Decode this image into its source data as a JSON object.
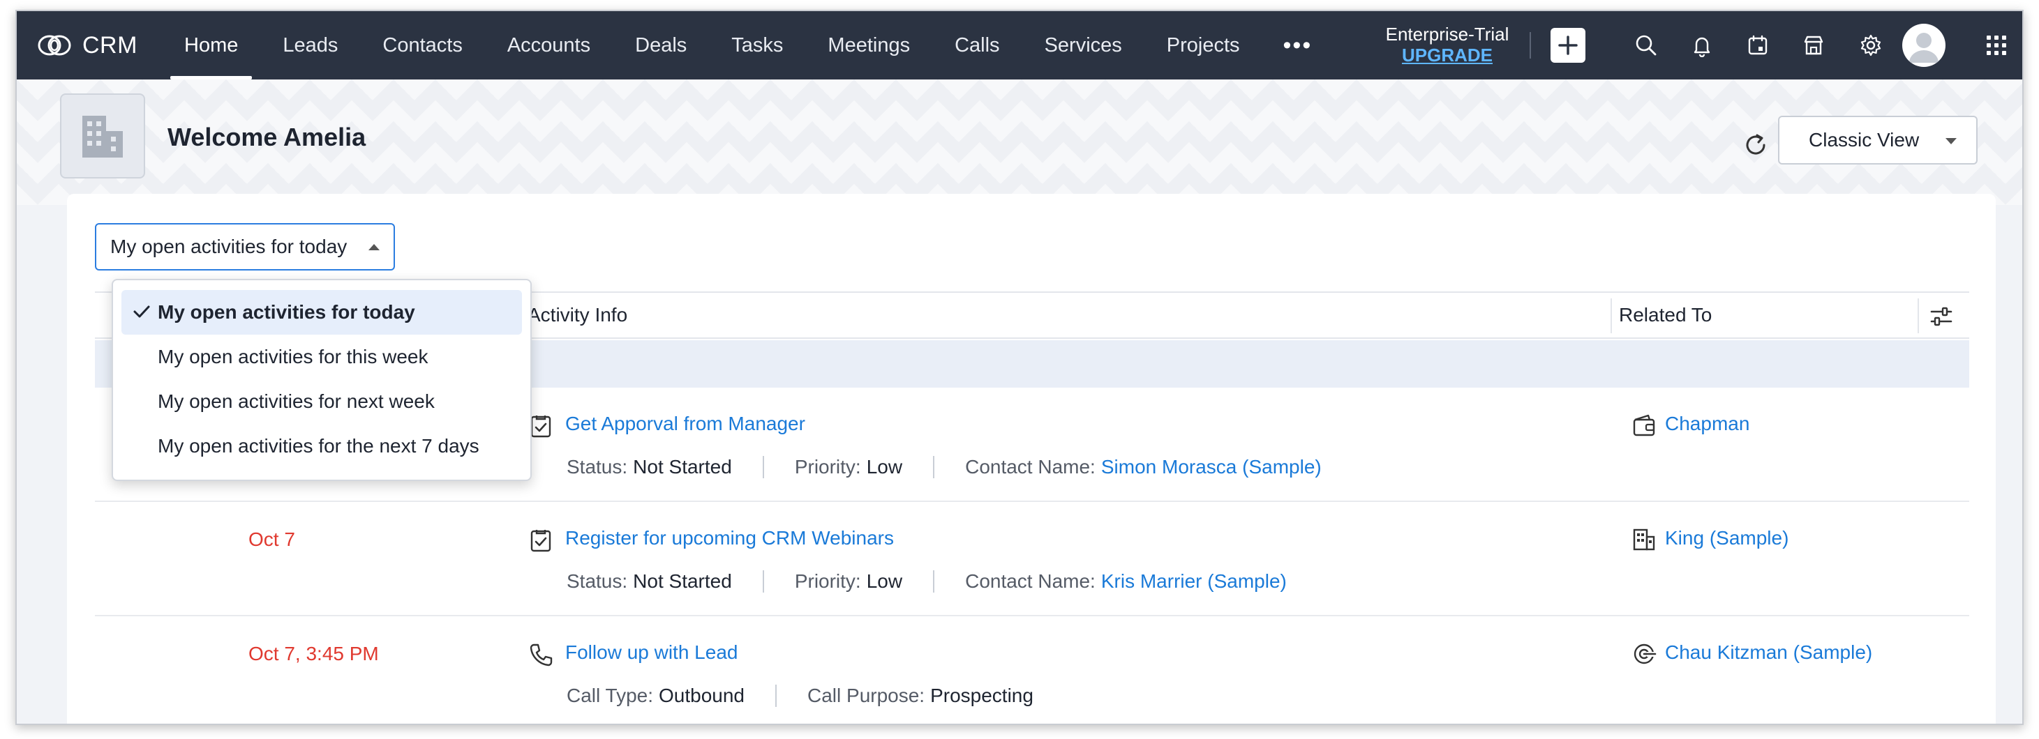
{
  "app": {
    "brand": "CRM"
  },
  "nav": {
    "items": [
      {
        "label": "Home",
        "active": true
      },
      {
        "label": "Leads"
      },
      {
        "label": "Contacts"
      },
      {
        "label": "Accounts"
      },
      {
        "label": "Deals"
      },
      {
        "label": "Tasks"
      },
      {
        "label": "Meetings"
      },
      {
        "label": "Calls"
      },
      {
        "label": "Services"
      },
      {
        "label": "Projects"
      }
    ],
    "more": "•••",
    "trial_line1": "Enterprise-Trial",
    "trial_line2": "UPGRADE"
  },
  "header": {
    "welcome": "Welcome Amelia",
    "view_select": "Classic View"
  },
  "filter": {
    "selected": "My open activities for today",
    "options": [
      {
        "label": "My open activities for today",
        "selected": true
      },
      {
        "label": "My open activities for this week"
      },
      {
        "label": "My open activities for next week"
      },
      {
        "label": "My open activities for the next 7 days"
      }
    ]
  },
  "table": {
    "columns": {
      "activity": "Activity Info",
      "related": "Related To"
    },
    "rows": [
      {
        "date": "",
        "type": "task",
        "title": "Get Apporval from Manager",
        "meta": [
          {
            "label": "Status:",
            "value": "Not Started"
          },
          {
            "label": "Priority:",
            "value": "Low"
          },
          {
            "label": "Contact Name:",
            "value": "Simon Morasca (Sample)",
            "link": true
          }
        ],
        "related_icon": "wallet-icon",
        "related": "Chapman"
      },
      {
        "date": "Oct 7",
        "type": "task",
        "title": "Register for upcoming CRM Webinars",
        "meta": [
          {
            "label": "Status:",
            "value": "Not Started"
          },
          {
            "label": "Priority:",
            "value": "Low"
          },
          {
            "label": "Contact Name:",
            "value": "Kris Marrier (Sample)",
            "link": true
          }
        ],
        "related_icon": "building-icon",
        "related": "King (Sample)"
      },
      {
        "date": "Oct 7, 3:45 PM",
        "type": "call",
        "title": "Follow up with Lead",
        "meta": [
          {
            "label": "Call Type:",
            "value": "Outbound"
          },
          {
            "label": "Call Purpose:",
            "value": "Prospecting"
          }
        ],
        "related_icon": "lead-icon",
        "related": "Chau Kitzman (Sample)"
      }
    ]
  },
  "colors": {
    "nav_bg": "#2b3342",
    "link": "#1a7ad8",
    "date_red": "#e0392f",
    "upgrade": "#5fb6ff"
  }
}
